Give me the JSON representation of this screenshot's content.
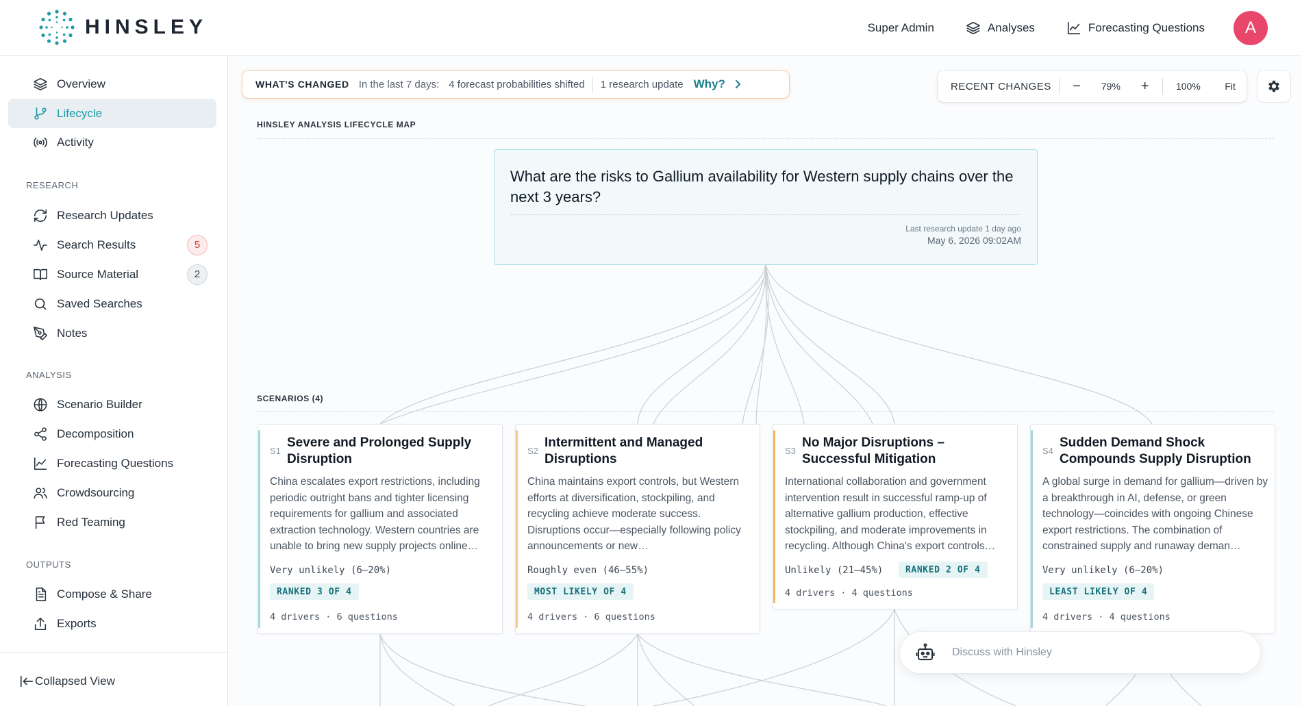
{
  "brand": {
    "name": "HINSLEY",
    "logo_icon": "dotted-ring-logo",
    "accent": "#1e9aa6"
  },
  "topnav": {
    "admin_label": "Super Admin",
    "analyses_label": "Analyses",
    "forecasting_label": "Forecasting Questions",
    "avatar_letter": "A",
    "avatar_color": "#e8466b"
  },
  "sidebar": {
    "top_items": [
      {
        "label": "Overview",
        "icon": "layers-icon"
      },
      {
        "label": "Lifecycle",
        "icon": "branch-icon",
        "active": true
      },
      {
        "label": "Activity",
        "icon": "broadcast-icon"
      }
    ],
    "sections": [
      {
        "title": "RESEARCH",
        "items": [
          {
            "label": "Research Updates",
            "icon": "refresh-icon"
          },
          {
            "label": "Search Results",
            "icon": "pulse-icon",
            "badge": "5"
          },
          {
            "label": "Source Material",
            "icon": "book-icon",
            "badge": "2"
          },
          {
            "label": "Saved Searches",
            "icon": "search-icon"
          },
          {
            "label": "Notes",
            "icon": "pen-icon"
          }
        ]
      },
      {
        "title": "ANALYSIS",
        "items": [
          {
            "label": "Scenario Builder",
            "icon": "globe-icon"
          },
          {
            "label": "Decomposition",
            "icon": "share-icon"
          },
          {
            "label": "Forecasting Questions",
            "icon": "chart-line-icon"
          },
          {
            "label": "Crowdsourcing",
            "icon": "users-icon"
          },
          {
            "label": "Red Teaming",
            "icon": "flag-icon"
          }
        ]
      },
      {
        "title": "OUTPUTS",
        "items": [
          {
            "label": "Compose & Share",
            "icon": "document-icon"
          },
          {
            "label": "Exports",
            "icon": "upload-icon"
          }
        ]
      }
    ],
    "collapse_label": "Collapsed View"
  },
  "whats_changed": {
    "heading": "WHAT'S CHANGED",
    "period": "In the last 7 days:",
    "shift": "4 forecast probabilities shifted",
    "research": "1 research update",
    "why": "Why?"
  },
  "toolbar": {
    "recent_label": "RECENT CHANGES",
    "zoom_out": "−",
    "zoom": "79%",
    "zoom_in": "+",
    "reset": "100%",
    "fit": "Fit"
  },
  "map": {
    "title": "HINSLEY ANALYSIS LIFECYCLE MAP",
    "question": "What are the risks to Gallium availability for Western supply chains over the next 3 years?",
    "last_update_label": "Last research update 1 day ago",
    "last_update_time": "May 6, 2026 09:02AM",
    "scenarios_title": "SCENARIOS (4)"
  },
  "scenarios": [
    {
      "id": "S1",
      "title": "Severe and Prolonged Supply Disruption",
      "description": "China escalates export restrictions, including periodic outright bans and tighter licensing requirements for gallium and associated extraction technology. Western countries are unable to bring new supply projects online…",
      "probability": "Very unlikely (6–20%)",
      "rank": "RANKED 3 OF 4",
      "meta": "4 drivers · 6 questions",
      "accent": "#9fd8de"
    },
    {
      "id": "S2",
      "title": "Intermittent and Managed Disruptions",
      "description": "China maintains export controls, but Western efforts at diversification, stockpiling, and recycling achieve moderate success. Disruptions occur—especially following policy announcements or new…",
      "probability": "Roughly even (46–55%)",
      "rank": "MOST LIKELY OF 4",
      "meta": "4 drivers · 6 questions",
      "accent": "#f6cc8e"
    },
    {
      "id": "S3",
      "title": "No Major Disruptions – Successful Mitigation",
      "description": "International collaboration and government intervention result in successful ramp-up of alternative gallium production, effective stockpiling, and moderate improvements in recycling. Although China's export controls…",
      "probability": "Unlikely (21–45%)",
      "rank": "RANKED 2 OF 4",
      "meta": "4 drivers · 4 questions",
      "accent": "#f2b95b"
    },
    {
      "id": "S4",
      "title": "Sudden Demand Shock Compounds Supply Disruption",
      "description": "A global surge in demand for gallium—driven by a breakthrough in AI, defense, or green technology—coincides with ongoing Chinese export restrictions. The combination of constrained supply and runaway deman…",
      "probability": "Very unlikely (6–20%)",
      "rank": "LEAST LIKELY OF 4",
      "meta": "4 drivers · 4 questions",
      "accent": "#9fd8de"
    }
  ],
  "discuss": {
    "placeholder": "Discuss with Hinsley",
    "icon": "robot-icon"
  }
}
